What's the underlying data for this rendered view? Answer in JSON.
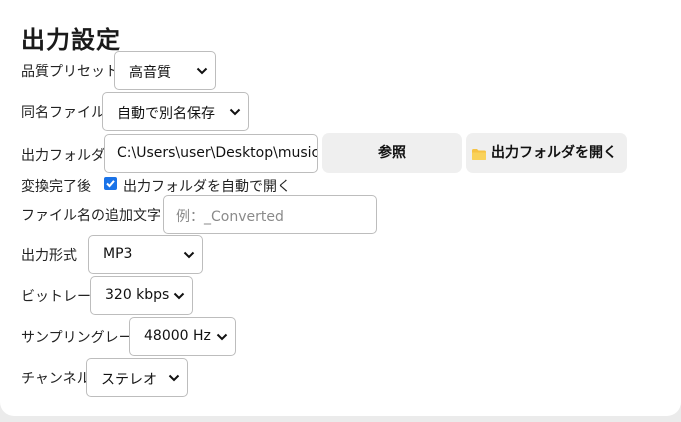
{
  "settings": {
    "title": "出力設定",
    "quality_preset": {
      "label": "品質プリセット",
      "value": "高音質"
    },
    "same_name_file": {
      "label": "同名ファイル",
      "value": "自動で別名保存"
    },
    "output_folder": {
      "label": "出力フォルダ",
      "value": "C:\\Users\\user\\Desktop\\music",
      "browse_button": "参照",
      "open_button": "出力フォルダを開く",
      "open_icon": "folder-icon"
    },
    "after_conversion": {
      "label": "変換完了後",
      "checked": true,
      "checkbox_label": "出力フォルダを自動で開く"
    },
    "suffix": {
      "label": "ファイル名の追加文字",
      "value": "",
      "placeholder": "例：_Converted"
    },
    "output_format": {
      "label": "出力形式",
      "value": "MP3"
    },
    "bitrate": {
      "label": "ビットレート",
      "value": "320 kbps"
    },
    "sampling_rate": {
      "label": "サンプリングレート",
      "value": "48000 Hz"
    },
    "channel": {
      "label": "チャンネル",
      "value": "ステレオ"
    }
  },
  "colors": {
    "accent": "#1a73e8",
    "button_bg": "#efefef",
    "folder_icon": "#f6c344"
  }
}
